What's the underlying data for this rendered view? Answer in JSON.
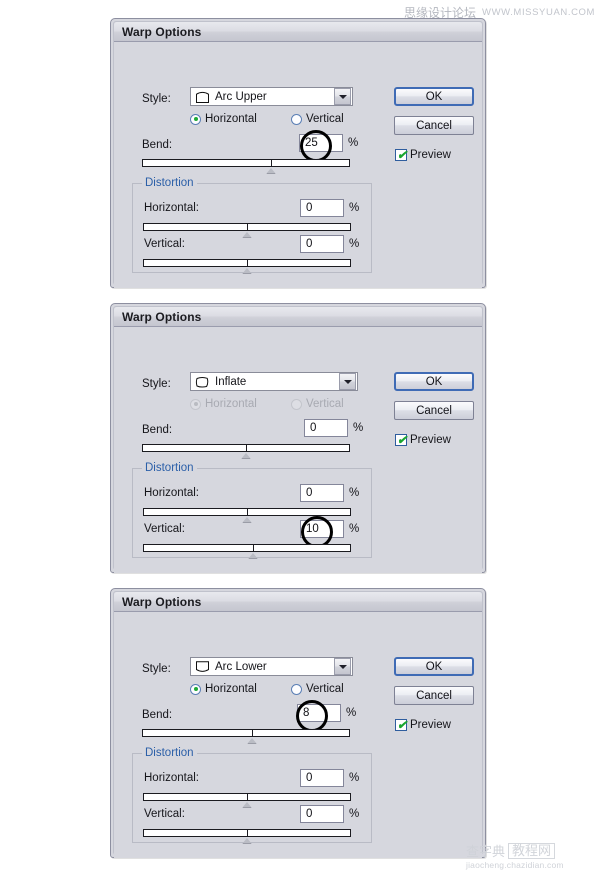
{
  "watermarks": {
    "top_cn": "思缘设计论坛",
    "top_en": "WWW.MISSYUAN.COM",
    "bottom_cn_1": "查字典",
    "bottom_cn_2": "教程网",
    "bottom_url": "jiaocheng.chazidian.com"
  },
  "common": {
    "title": "Warp Options",
    "style_label": "Style:",
    "horizontal_label": "Horizontal",
    "vertical_label": "Vertical",
    "bend_label": "Bend:",
    "distortion_label": "Distortion",
    "dist_horizontal_label": "Horizontal:",
    "dist_vertical_label": "Vertical:",
    "percent": "%",
    "ok_label": "OK",
    "cancel_label": "Cancel",
    "preview_label": "Preview",
    "accent_blue": "#2b5fa8",
    "default_button_border": "#3f6bb5",
    "check_green": "#19a62f",
    "dialog_face": "#d6d7de"
  },
  "dialogs": [
    {
      "id": "warp-options-arc-upper",
      "title": "Warp Options",
      "style_value": "Arc Upper",
      "style_icon": "arc-upper-shape-icon",
      "orientation": "Horizontal",
      "orientation_enabled": true,
      "bend_value": "25",
      "bend_slider_pct": 62,
      "distortion_horizontal_value": "0",
      "distortion_horizontal_slider_pct": 50,
      "distortion_vertical_value": "0",
      "distortion_vertical_slider_pct": 50,
      "preview_checked": true,
      "highlight_field": "bend"
    },
    {
      "id": "warp-options-inflate",
      "title": "Warp Options",
      "style_value": "Inflate",
      "style_icon": "inflate-shape-icon",
      "orientation": "Horizontal",
      "orientation_enabled": false,
      "bend_value": "0",
      "bend_slider_pct": 50,
      "distortion_horizontal_value": "0",
      "distortion_horizontal_slider_pct": 50,
      "distortion_vertical_value": "10",
      "distortion_vertical_slider_pct": 53,
      "preview_checked": true,
      "highlight_field": "distortion_vertical"
    },
    {
      "id": "warp-options-arc-lower",
      "title": "Warp Options",
      "style_value": "Arc Lower",
      "style_icon": "arc-lower-shape-icon",
      "orientation": "Horizontal",
      "orientation_enabled": true,
      "bend_value": "8",
      "bend_slider_pct": 53,
      "distortion_horizontal_value": "0",
      "distortion_horizontal_slider_pct": 50,
      "distortion_vertical_value": "0",
      "distortion_vertical_slider_pct": 50,
      "preview_checked": true,
      "highlight_field": "bend"
    }
  ]
}
